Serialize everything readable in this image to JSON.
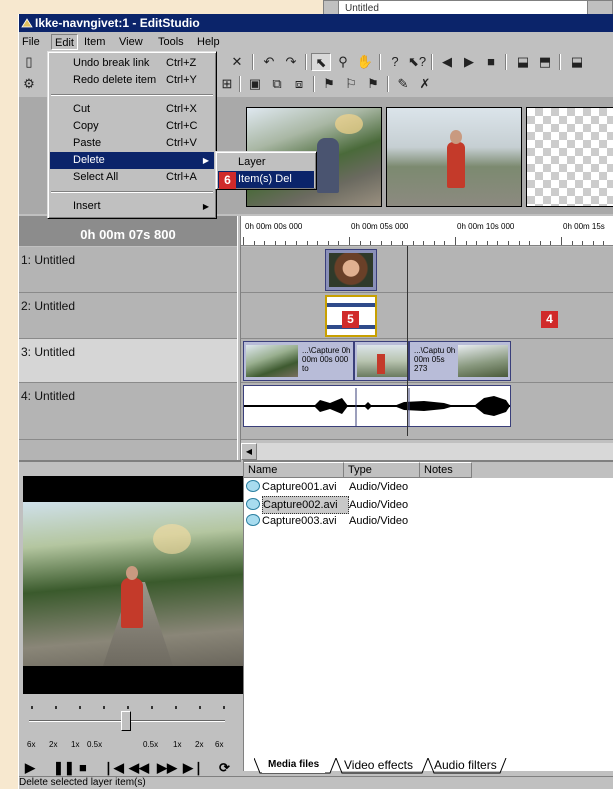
{
  "app": {
    "title": "Ikke-navngivet:1 - EditStudio",
    "background_title": "Untitled"
  },
  "menubar": {
    "items": [
      "File",
      "Edit",
      "Item",
      "View",
      "Tools",
      "Help"
    ]
  },
  "edit_menu": {
    "items": [
      {
        "label": "Undo break link",
        "shortcut": "Ctrl+Z"
      },
      {
        "label": "Redo delete item",
        "shortcut": "Ctrl+Y"
      },
      {
        "label": "Cut",
        "shortcut": "Ctrl+X"
      },
      {
        "label": "Copy",
        "shortcut": "Ctrl+C"
      },
      {
        "label": "Paste",
        "shortcut": "Ctrl+V"
      },
      {
        "label": "Delete",
        "shortcut": ""
      },
      {
        "label": "Select All",
        "shortcut": "Ctrl+A"
      },
      {
        "label": "Insert",
        "shortcut": ""
      }
    ]
  },
  "delete_submenu": {
    "items": [
      {
        "label": "Layer",
        "shortcut": ""
      },
      {
        "label": "Item(s)",
        "shortcut": "Del"
      }
    ]
  },
  "timeline": {
    "current_time": "0h 00m 07s 800",
    "ruler_labels": [
      "0h 00m 00s 000",
      "0h 00m 05s 000",
      "0h 00m 10s 000",
      "0h 00m 15s"
    ],
    "layers": [
      "1: Untitled",
      "2: Untitled",
      "3: Untitled",
      "4: Untitled"
    ],
    "clips": [
      {
        "text": "...\\Capture 0h 00m 00s 000 to"
      },
      {
        "text": "...\\Captu 0h 00m 05s 273"
      }
    ]
  },
  "callouts": {
    "item4": "4",
    "item5": "5",
    "item6": "6"
  },
  "monitor": {
    "speed_labels": [
      "6x",
      "2x",
      "1x",
      "0.5x",
      "0.5x",
      "1x",
      "2x",
      "6x"
    ]
  },
  "media": {
    "columns": [
      "Name",
      "Type",
      "Notes"
    ],
    "rows": [
      {
        "name": "Capture001.avi",
        "type": "Audio/Video"
      },
      {
        "name": "Capture002.avi",
        "type": "Audio/Video"
      },
      {
        "name": "Capture003.avi",
        "type": "Audio/Video"
      }
    ],
    "tabs": [
      "Media files",
      "Video effects",
      "Audio filters"
    ]
  },
  "status": {
    "text": "Delete selected layer item(s)"
  },
  "colors": {
    "titlebar": "#0b246a",
    "menu_highlight": "#0b246a",
    "callout_red": "#d02a2a",
    "clip_fill": "#b8bcd8",
    "page_background": "#f7e8cf"
  }
}
